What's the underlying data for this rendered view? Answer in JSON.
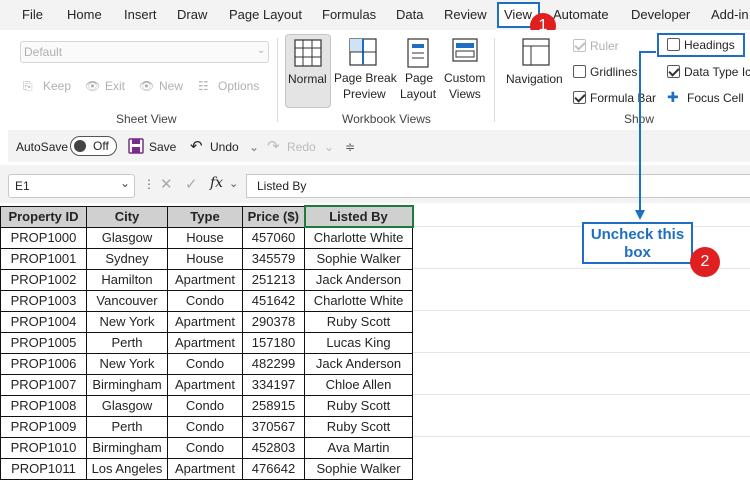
{
  "menu": {
    "items": [
      "File",
      "Home",
      "Insert",
      "Draw",
      "Page Layout",
      "Formulas",
      "Data",
      "Review",
      "View",
      "Automate",
      "Developer",
      "Add-in"
    ]
  },
  "badges": {
    "one": "1",
    "two": "2"
  },
  "ribbon": {
    "sheet_view": {
      "dropdown_value": "Default",
      "keep": "Keep",
      "exit": "Exit",
      "new": "New",
      "options": "Options",
      "group_label": "Sheet View"
    },
    "workbook_views": {
      "normal": "Normal",
      "page_break_preview_1": "Page Break",
      "page_break_preview_2": "Preview",
      "page_layout_1": "Page",
      "page_layout_2": "Layout",
      "custom_views_1": "Custom",
      "custom_views_2": "Views",
      "group_label": "Workbook Views"
    },
    "show": {
      "navigation": "Navigation",
      "ruler": "Ruler",
      "gridlines": "Gridlines",
      "formula_bar": "Formula Bar",
      "headings": "Headings",
      "data_type_icons": "Data Type Ico",
      "focus_cell": "Focus Cell",
      "group_label": "Show"
    }
  },
  "qat": {
    "autosave": "AutoSave",
    "toggle": "Off",
    "save": "Save",
    "undo": "Undo",
    "redo": "Redo"
  },
  "formula_bar": {
    "name_box": "E1",
    "fx": "fx",
    "content": "Listed By"
  },
  "callout": {
    "line1": "Uncheck this",
    "line2": "box"
  },
  "sheet": {
    "headers": [
      "Property ID",
      "City",
      "Type",
      "Price ($)",
      "Listed By"
    ],
    "rows": [
      [
        "PROP1000",
        "Glasgow",
        "House",
        "457060",
        "Charlotte White"
      ],
      [
        "PROP1001",
        "Sydney",
        "House",
        "345579",
        "Sophie Walker"
      ],
      [
        "PROP1002",
        "Hamilton",
        "Apartment",
        "251213",
        "Jack Anderson"
      ],
      [
        "PROP1003",
        "Vancouver",
        "Condo",
        "451642",
        "Charlotte White"
      ],
      [
        "PROP1004",
        "New York",
        "Apartment",
        "290378",
        "Ruby Scott"
      ],
      [
        "PROP1005",
        "Perth",
        "Apartment",
        "157180",
        "Lucas King"
      ],
      [
        "PROP1006",
        "New York",
        "Condo",
        "482299",
        "Jack Anderson"
      ],
      [
        "PROP1007",
        "Birmingham",
        "Apartment",
        "334197",
        "Chloe Allen"
      ],
      [
        "PROP1008",
        "Glasgow",
        "Condo",
        "258915",
        "Ruby Scott"
      ],
      [
        "PROP1009",
        "Perth",
        "Condo",
        "370567",
        "Ruby Scott"
      ],
      [
        "PROP1010",
        "Birmingham",
        "Condo",
        "452803",
        "Ava Martin"
      ],
      [
        "PROP1011",
        "Los Angeles",
        "Apartment",
        "476642",
        "Sophie Walker"
      ]
    ]
  },
  "colors": {
    "accent_blue": "#1e6fc3",
    "badge_red": "#e02020",
    "header_gray": "#d0d0d0"
  }
}
